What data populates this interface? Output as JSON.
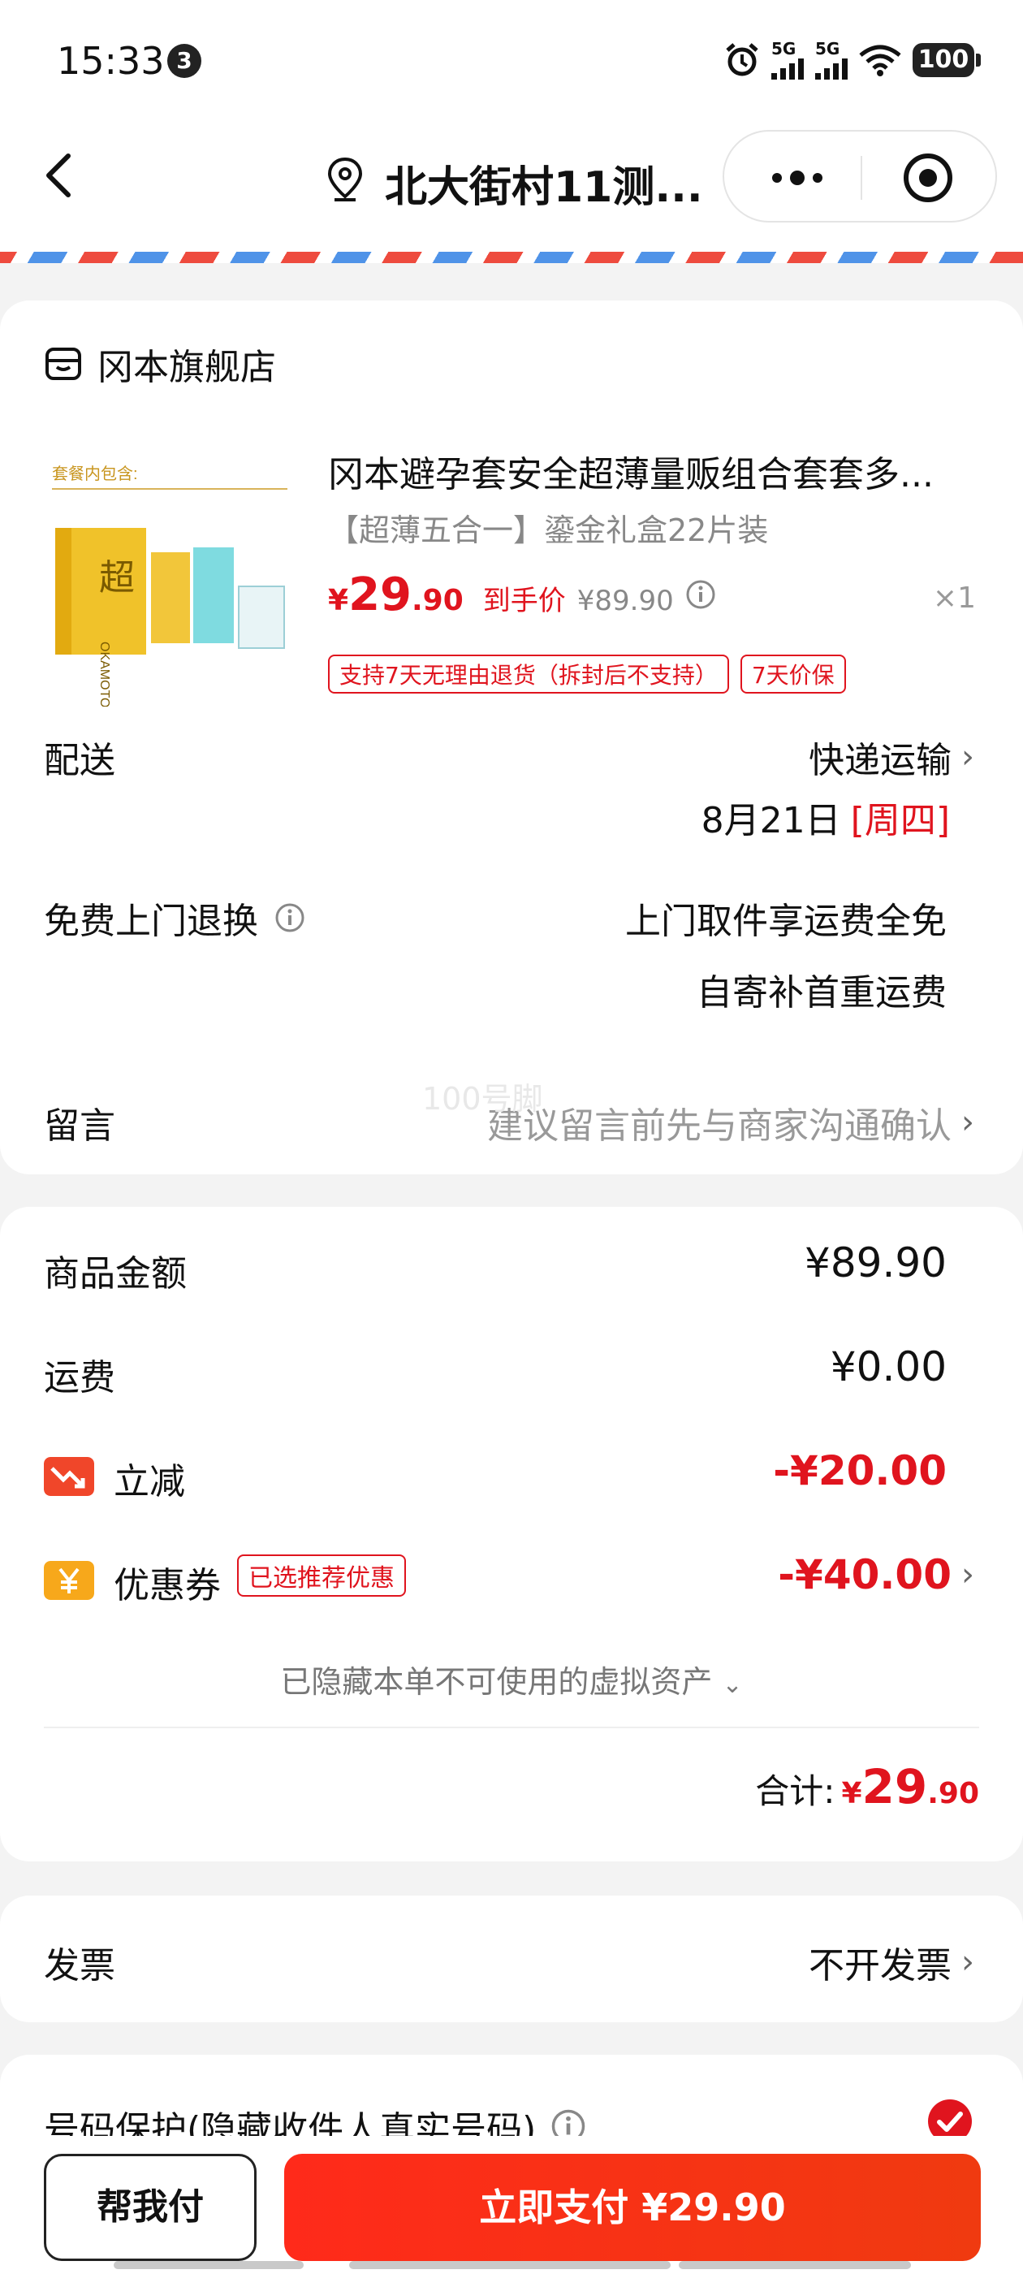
{
  "status_bar": {
    "time": "15:33",
    "notif_count": "3",
    "network_1": "5G",
    "network_2": "5G",
    "battery": "100"
  },
  "nav": {
    "title": "北大街村11测..."
  },
  "store": {
    "name": "冈本旗舰店"
  },
  "product": {
    "title": "冈本避孕套安全超薄量贩组合套套多...",
    "spec": "【超薄五合一】鎏金礼盒22片装",
    "price_symbol": "¥",
    "price_int": "29",
    "price_dec": ".90",
    "price_label": "到手价",
    "orig_price": "¥89.90",
    "quantity": "×1",
    "tags": [
      "支持7天无理由退货（拆封后不支持）",
      "7天价保"
    ],
    "image_caption": "套餐内包含:",
    "image_brand": "OKAMOTO"
  },
  "delivery": {
    "label": "配送",
    "method": "快递运输",
    "date": "8月21日",
    "weekday": "[周四]"
  },
  "returns": {
    "label": "免费上门退换",
    "line1": "上门取件享运费全免",
    "line2": "自寄补首重运费"
  },
  "message": {
    "label": "留言",
    "placeholder": "建议留言前先与商家沟通确认"
  },
  "watermark": "100号脚",
  "summary": {
    "goods_label": "商品金额",
    "goods_value": "¥89.90",
    "shipping_label": "运费",
    "shipping_value": "¥0.00",
    "discount_label": "立减",
    "discount_value": "-¥20.00",
    "coupon_label": "优惠券",
    "coupon_tag": "已选推荐优惠",
    "coupon_value": "-¥40.00",
    "hidden_assets": "已隐藏本单不可使用的虚拟资产",
    "total_label": "合计:",
    "total_symbol": "¥",
    "total_int": "29",
    "total_dec": ".90"
  },
  "invoice": {
    "label": "发票",
    "value": "不开发票"
  },
  "privacy": {
    "label": "号码保护(隐藏收件人真实号码)"
  },
  "bottom": {
    "help_label": "帮我付",
    "pay_label": "立即支付 ¥29.90"
  },
  "colors": {
    "accent_red": "#e0141e",
    "pay_button": "#ff2a1a",
    "airmail_blue": "#4f93e8"
  }
}
